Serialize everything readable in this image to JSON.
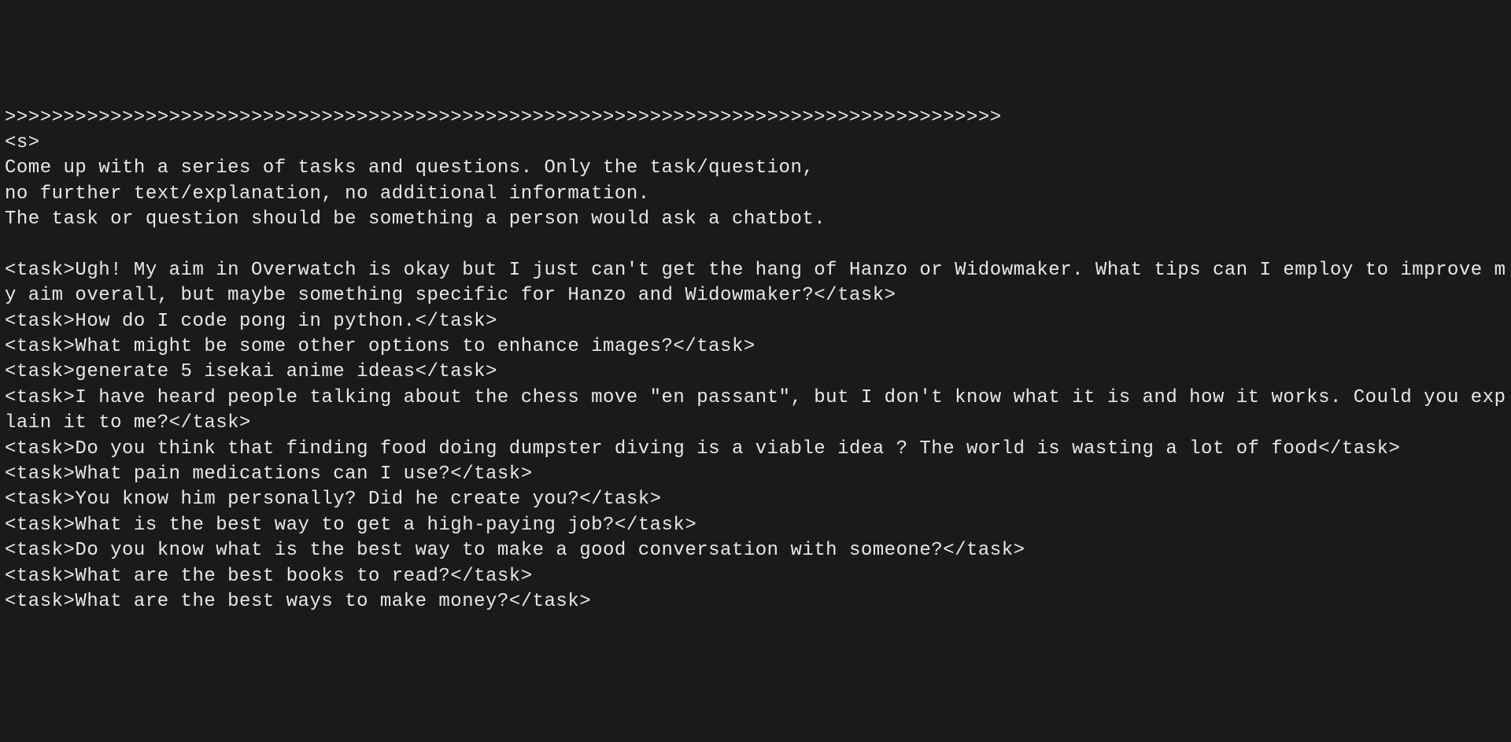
{
  "terminal": {
    "separator": ">>>>>>>>>>>>>>>>>>>>>>>>>>>>>>>>>>>>>>>>>>>>>>>>>>>>>>>>>>>>>>>>>>>>>>>>>>>>>>>>>>>>>",
    "start_tag": "<s>",
    "prompt_line1": "Come up with a series of tasks and questions. Only the task/question,",
    "prompt_line2": "no further text/explanation, no additional information.",
    "prompt_line3": "The task or question should be something a person would ask a chatbot.",
    "tasks": [
      "<task>Ugh! My aim in Overwatch is okay but I just can't get the hang of Hanzo or Widowmaker. What tips can I employ to improve my aim overall, but maybe something specific for Hanzo and Widowmaker?</task>",
      "<task>How do I code pong in python.</task>",
      "<task>What might be some other options to enhance images?</task>",
      "<task>generate 5 isekai anime ideas</task>",
      "<task>I have heard people talking about the chess move \"en passant\", but I don't know what it is and how it works. Could you explain it to me?</task>",
      "<task>Do you think that finding food doing dumpster diving is a viable idea ? The world is wasting a lot of food</task>",
      "<task>What pain medications can I use?</task>",
      "<task>You know him personally? Did he create you?</task>",
      "<task>What is the best way to get a high-paying job?</task>",
      "<task>Do you know what is the best way to make a good conversation with someone?</task>",
      "<task>What are the best books to read?</task>",
      "<task>What are the best ways to make money?</task>"
    ]
  }
}
